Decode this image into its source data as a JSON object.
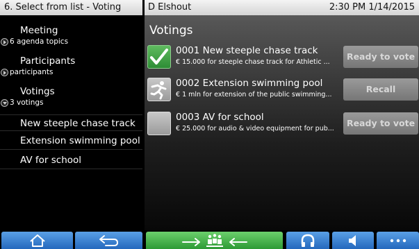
{
  "header": {
    "title": "6. Select from list - Voting",
    "user": "D Elshout",
    "time": "2:30 PM 1/14/2015"
  },
  "sidebar": {
    "meeting": {
      "label": "Meeting",
      "sub": "6 agenda topics"
    },
    "participants": {
      "label": "Participants",
      "sub": "participants"
    },
    "votings": {
      "label": "Votings",
      "sub": "3 votings"
    },
    "items": [
      "New steeple chase track",
      "Extension swimming pool",
      "AV for school"
    ]
  },
  "main": {
    "title": "Votings",
    "rows": [
      {
        "title": "0001  New steeple chase track",
        "desc": "€ 15.000 for steeple chase track for Athletic ...",
        "button": "Ready to vote",
        "icon": "checkmark-icon"
      },
      {
        "title": "0002  Extension swimming pool",
        "desc": "€ 1 mln for extension of the public swimming...",
        "button": "Recall",
        "icon": "running-person-icon"
      },
      {
        "title": "0003  AV for school",
        "desc": "€ 25.000 for audio & video equipment for pub...",
        "button": "Ready to vote",
        "icon": "empty-icon"
      }
    ]
  },
  "colors": {
    "accent_blue": "#3a85d6",
    "accent_green": "#3fae45",
    "button_gray": "#888888"
  },
  "footer": {
    "icons": [
      "home-icon",
      "back-icon",
      "interpretation-icon",
      "headphones-icon",
      "speaker-icon",
      "more-icon"
    ]
  }
}
